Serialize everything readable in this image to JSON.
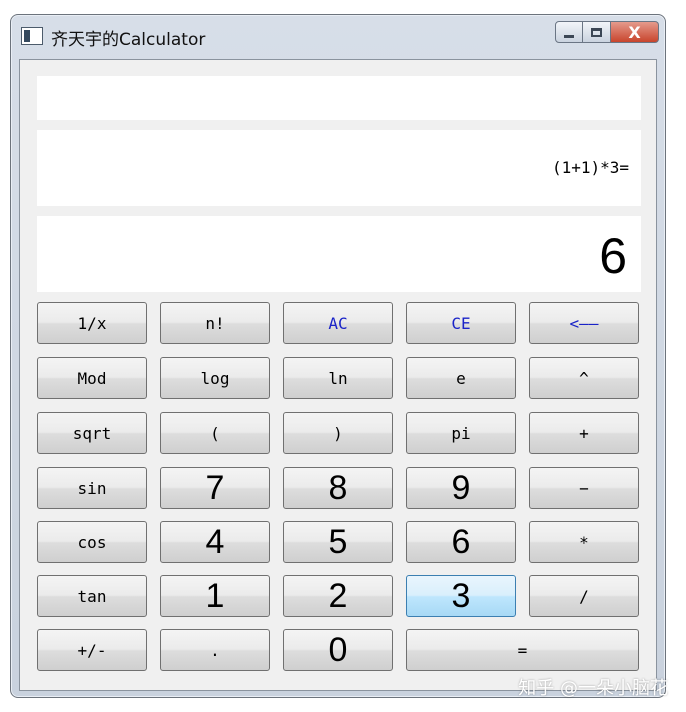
{
  "window": {
    "title": "齐天宇的Calculator",
    "close_glyph": "X"
  },
  "display": {
    "line1": "",
    "expression": "(1+1)*3=",
    "result": "6"
  },
  "buttons": [
    [
      "1/x",
      "n!",
      "AC",
      "CE",
      "<——"
    ],
    [
      "Mod",
      "log",
      "ln",
      "e",
      "^"
    ],
    [
      "sqrt",
      "(",
      ")",
      "pi",
      "+"
    ],
    [
      "sin",
      "7",
      "8",
      "9",
      "−"
    ],
    [
      "cos",
      "4",
      "5",
      "6",
      "*"
    ],
    [
      "tan",
      "1",
      "2",
      "3",
      "/"
    ],
    [
      "+/-",
      ".",
      "0",
      "="
    ]
  ],
  "watermark": "知乎 @一朵小脑花"
}
